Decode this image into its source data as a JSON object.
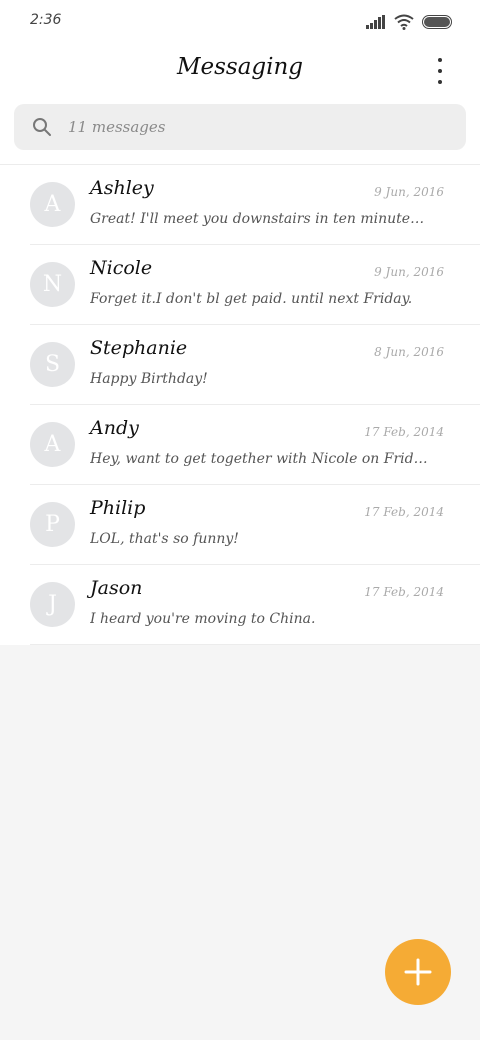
{
  "status_bar": {
    "time": "2:36",
    "icons": [
      "signal-icon",
      "wifi-icon",
      "battery-icon"
    ]
  },
  "header": {
    "title": "Messaging",
    "menu_icon": "more-vertical-icon"
  },
  "search": {
    "placeholder": "11 messages",
    "icon": "search-icon"
  },
  "conversations": [
    {
      "initial": "A",
      "name": "Ashley",
      "date": "9 Jun, 2016",
      "preview": "Great! I'll meet you downstairs in ten minutes. Do..."
    },
    {
      "initial": "N",
      "name": "Nicole",
      "date": "9 Jun, 2016",
      "preview": "Forget it.I don't bl get paid. until next Friday."
    },
    {
      "initial": "S",
      "name": "Stephanie",
      "date": "8 Jun, 2016",
      "preview": "Happy Birthday!"
    },
    {
      "initial": "A",
      "name": "Andy",
      "date": "17 Feb, 2014",
      "preview": "Hey, want to get together with Nicole on Friday?"
    },
    {
      "initial": "P",
      "name": "Philip",
      "date": "17 Feb, 2014",
      "preview": "LOL, that's so funny!"
    },
    {
      "initial": "J",
      "name": "Jason",
      "date": "17 Feb, 2014",
      "preview": "I heard you're moving to China."
    }
  ],
  "fab": {
    "icon": "plus-icon",
    "color": "#f5ab35"
  },
  "colors": {
    "background": "#f5f5f5",
    "avatar": "#e3e4e6",
    "accent": "#f5ab35"
  }
}
